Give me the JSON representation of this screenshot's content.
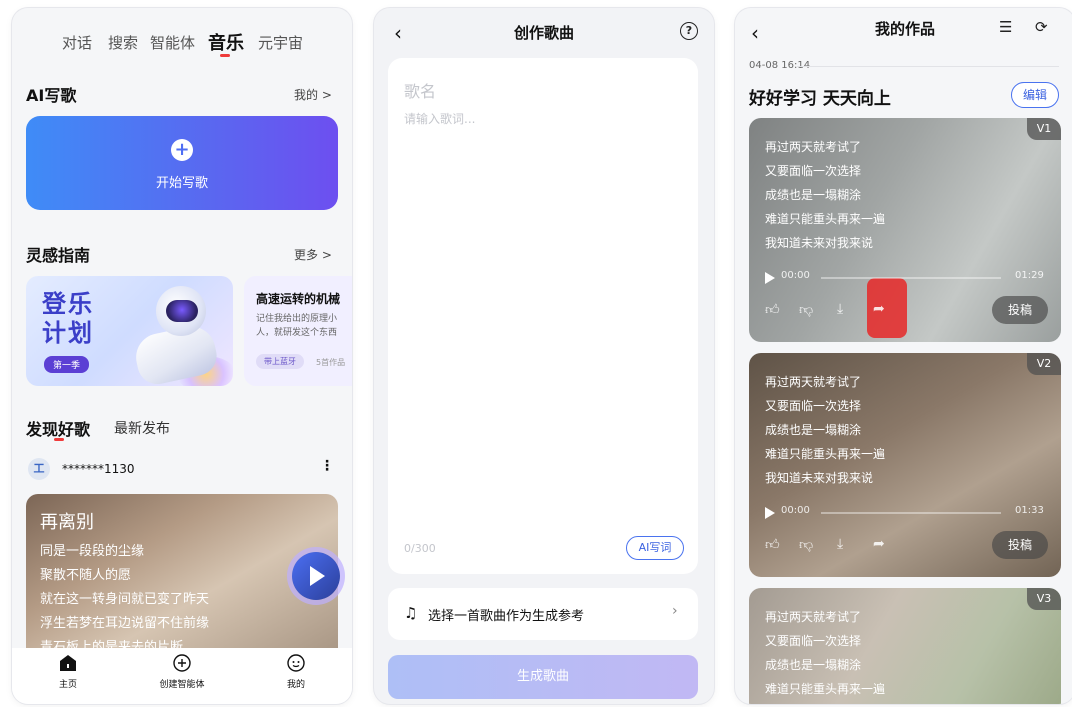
{
  "screen1": {
    "tabs": [
      "对话",
      "搜索",
      "智能体",
      "音乐",
      "元宇宙"
    ],
    "active_tab": "音乐",
    "ai_write": {
      "title": "AI写歌",
      "more": "我的 >",
      "card_label": "开始写歌"
    },
    "inspiration": {
      "title": "灵感指南",
      "more": "更多 >",
      "card1": {
        "title_line1": "登乐",
        "title_line2": "计划",
        "badge": "第一季"
      },
      "card2": {
        "title": "高速运转的机械",
        "desc_line1": "记住我给出的原理小",
        "desc_line2": "人，就研发这个东西",
        "tag": "带上蓝牙",
        "count": "5首作品"
      }
    },
    "discover": {
      "tab_active": "发现好歌",
      "tab_other": "最新发布"
    },
    "song_item": {
      "user": "*******1130",
      "user_icon_text": "工",
      "title": "再离别",
      "lines": [
        "同是一段段的尘缘",
        "聚散不随人的愿",
        "就在这一转身间就已变了昨天",
        "浮生若梦在耳边说留不住前缘",
        "青石板上的是来去的片断"
      ]
    },
    "nav": [
      "主页",
      "创建智能体",
      "我的"
    ]
  },
  "screen2": {
    "title": "创作歌曲",
    "song_name_placeholder": "歌名",
    "lyrics_placeholder": "请输入歌词...",
    "char_count": "0/300",
    "ai_button": "AI写词",
    "reference_text": "选择一首歌曲作为生成参考",
    "generate_button": "生成歌曲"
  },
  "screen3": {
    "title": "我的作品",
    "timestamp": "04-08 16:14",
    "work_title": "好好学习 天天向上",
    "edit_button": "编辑",
    "lyrics": [
      "再过两天就考试了",
      "又要面临一次选择",
      "成绩也是一塌糊涂",
      "难道只能重头再来一遍",
      "我知道未来对我来说"
    ],
    "versions": [
      {
        "label": "V1",
        "time_start": "00:00",
        "time_end": "01:29",
        "submit": "投稿"
      },
      {
        "label": "V2",
        "time_start": "00:00",
        "time_end": "01:33",
        "submit": "投稿"
      },
      {
        "label": "V3"
      }
    ]
  },
  "colors": {
    "accent": "#4a73ef",
    "active_tab_underline": "#ef3b3b",
    "write_card_start": "#3f8cf7",
    "write_card_end": "#6d4ff0"
  }
}
